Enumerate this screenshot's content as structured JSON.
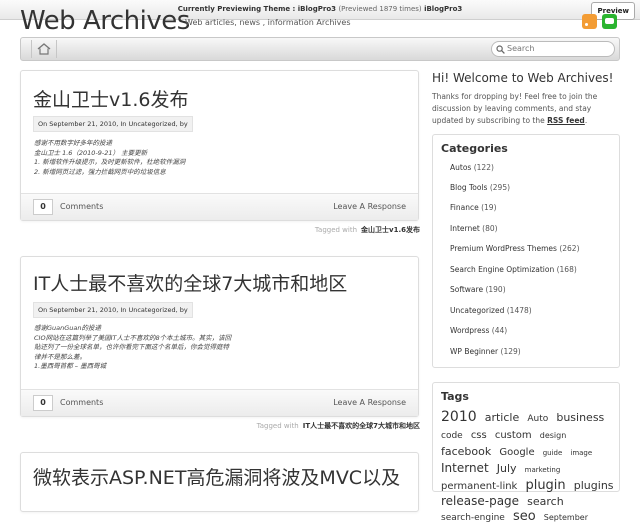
{
  "preview_bar": {
    "label": "Currently Previewing Theme :",
    "theme": "iBlogPro3",
    "count": "(Previewed 1879 times)",
    "theme_repeat": "iBlogPro3",
    "button": "Preview"
  },
  "header": {
    "site_title": "Web Archives",
    "tagline": "Web articles, news , information Archives",
    "icons": [
      "rss-icon",
      "chat-icon"
    ]
  },
  "nav": {
    "home_icon": "home-icon",
    "search_placeholder": "Search"
  },
  "posts": [
    {
      "title": "金山卫士v1.6发布",
      "meta": "On September 21, 2010, In Uncategorized, by",
      "excerpt": [
        "感谢不用数字好多年的投递",
        "金山卫士 1.6（2010-9-21） 主要更新",
        "1. 新增软件升级提示，及时更新软件，杜绝软件漏洞",
        "2. 新增网页过滤，强力拦截网页中的垃圾信息"
      ],
      "comment_count": "0",
      "comments_label": "Comments",
      "leave_response": "Leave A Response",
      "tagged_label": "Tagged with",
      "tag": "金山卫士v1.6发布"
    },
    {
      "title": "IT人士最不喜欢的全球7大城市和地区",
      "meta": "On September 21, 2010, In Uncategorized, by",
      "excerpt": [
        "感谢GuanGuan的投递",
        "CIO网站在这篇列举了美国IT人士不喜欢的8个本土城市。其实，该回",
        "贴还列了一份全球名单，也许你看完下面这个名单后，你会觉得庭特",
        "律并不是那么差。",
        "1.墨西哥首都 – 墨西哥城"
      ],
      "comment_count": "0",
      "comments_label": "Comments",
      "leave_response": "Leave A Response",
      "tagged_label": "Tagged with",
      "tag": "IT人士最不喜欢的全球7大城市和地区"
    },
    {
      "title": "微软表示ASP.NET高危漏洞将波及MVC以及"
    }
  ],
  "sidebar": {
    "welcome_title": "Hi! Welcome to Web Archives!",
    "welcome_text": "Thanks for dropping by! Feel free to join the discussion by leaving comments, and stay updated by subscribing to the",
    "welcome_link": "RSS feed",
    "welcome_end": ".",
    "categories_title": "Categories",
    "categories": [
      {
        "name": "Autos",
        "count": "(122)"
      },
      {
        "name": "Blog Tools",
        "count": "(295)"
      },
      {
        "name": "Finance",
        "count": "(19)"
      },
      {
        "name": "Internet",
        "count": "(80)"
      },
      {
        "name": "Premium WordPress Themes",
        "count": "(262)"
      },
      {
        "name": "Search Engine Optimization",
        "count": "(168)"
      },
      {
        "name": "Software",
        "count": "(190)"
      },
      {
        "name": "Uncategorized",
        "count": "(1478)"
      },
      {
        "name": "Wordpress",
        "count": "(44)"
      },
      {
        "name": "WP Beginner",
        "count": "(129)"
      }
    ],
    "tags_title": "Tags",
    "tags": [
      {
        "t": "2010",
        "s": 14
      },
      {
        "t": "article",
        "s": 11
      },
      {
        "t": "Auto",
        "s": 9
      },
      {
        "t": "business",
        "s": 11
      },
      {
        "t": "code",
        "s": 9
      },
      {
        "t": "css",
        "s": 10
      },
      {
        "t": "custom",
        "s": 10
      },
      {
        "t": "design",
        "s": 8
      },
      {
        "t": "facebook",
        "s": 11
      },
      {
        "t": "Google",
        "s": 10
      },
      {
        "t": "guide",
        "s": 7
      },
      {
        "t": "image",
        "s": 7
      },
      {
        "t": "Internet",
        "s": 12
      },
      {
        "t": "July",
        "s": 11
      },
      {
        "t": "marketing",
        "s": 7
      },
      {
        "t": "permanent-link",
        "s": 10
      },
      {
        "t": "plugin",
        "s": 13
      },
      {
        "t": "plugins",
        "s": 11
      },
      {
        "t": "release-page",
        "s": 12
      },
      {
        "t": "search",
        "s": 11
      },
      {
        "t": "search-engine",
        "s": 9
      },
      {
        "t": "seo",
        "s": 13
      },
      {
        "t": "September",
        "s": 8
      }
    ]
  }
}
